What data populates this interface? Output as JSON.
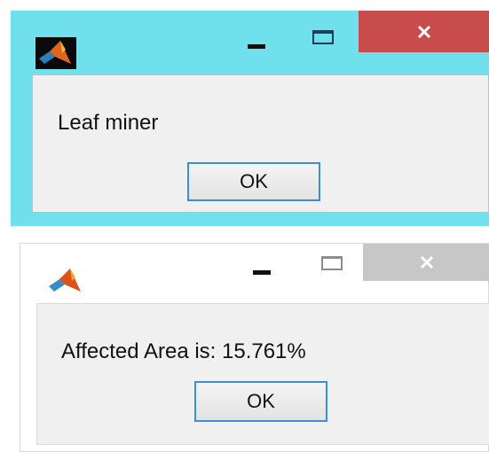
{
  "dialogs": [
    {
      "message": "Leaf miner",
      "ok_label": "OK",
      "state": "active",
      "close_label": "×"
    },
    {
      "message": "Affected Area is: 15.761%",
      "ok_label": "OK",
      "state": "inactive",
      "close_label": "×"
    }
  ],
  "icons": {
    "app": "matlab-logo-icon",
    "minimize": "minimize-icon",
    "maximize": "maximize-icon",
    "close": "close-icon"
  },
  "colors": {
    "active_frame": "#6fe0ec",
    "active_close": "#c94c4c",
    "inactive_close": "#c7c7c7",
    "content_background": "#f0f0f0",
    "button_border": "#3c8ed6"
  }
}
